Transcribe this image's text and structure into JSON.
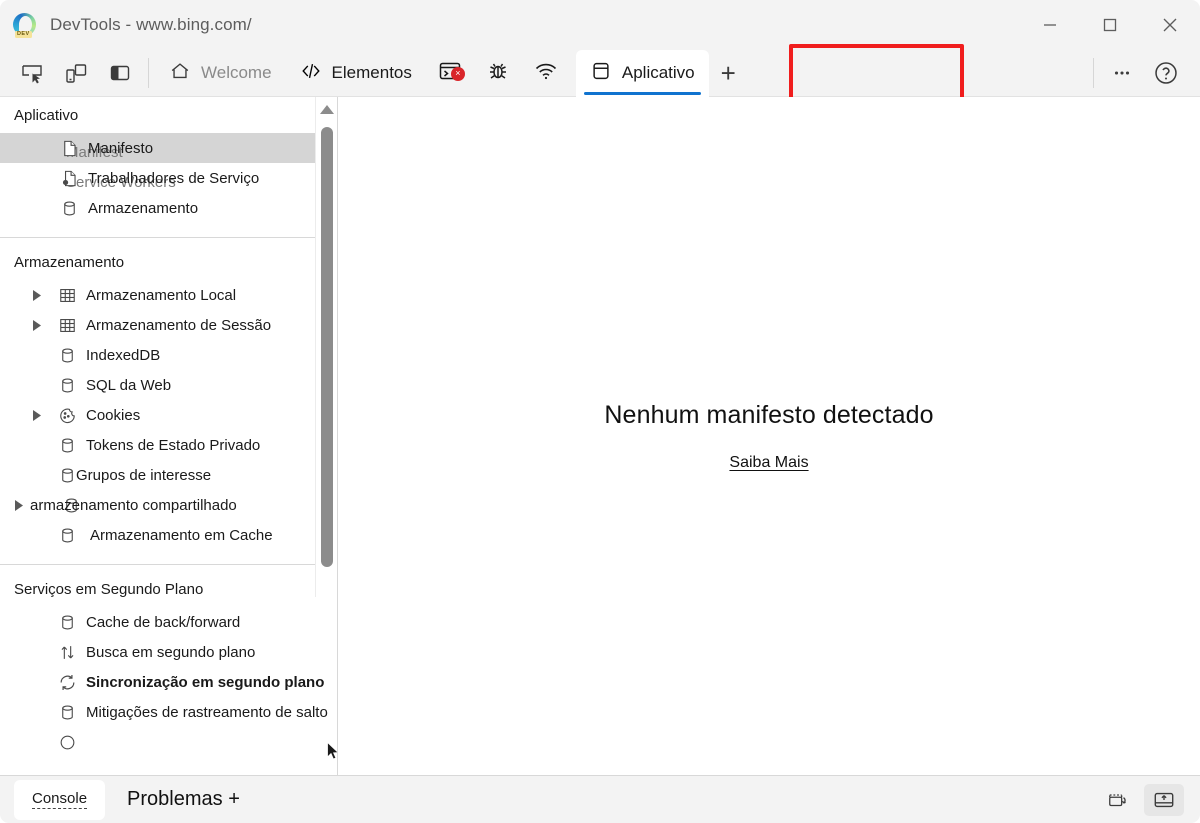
{
  "window": {
    "title": "DevTools - www.bing.com/",
    "logo_badge": "DEV",
    "controls": {
      "minimize": "minimize-button",
      "maximize": "maximize-button",
      "close": "close-button"
    }
  },
  "toolbar": {
    "left_icons": [
      {
        "name": "inspect-element-icon",
        "title": "Inspect"
      },
      {
        "name": "device-emulation-icon",
        "title": "Device emulation"
      },
      {
        "name": "panel-layout-icon",
        "title": "Panel layout"
      }
    ],
    "tabs": [
      {
        "label": "Welcome",
        "icon": "home-icon",
        "active": false
      },
      {
        "label": "Elementos",
        "icon": "code-brackets-icon",
        "active": false
      },
      {
        "label": "",
        "icon": "console-error-icon",
        "active": false,
        "badge": "×"
      },
      {
        "label": "",
        "icon": "bug-debugger-icon",
        "active": false
      },
      {
        "label": "",
        "icon": "network-wifi-icon",
        "active": false
      },
      {
        "label": "Aplicativo",
        "icon": "application-panel-icon",
        "active": true
      }
    ],
    "add_tab": "+",
    "more_options": "•••",
    "help": "?",
    "active_tab_accent": "#1073cf",
    "highlight_color": "#f01d1d"
  },
  "sidebar": {
    "sections": [
      {
        "header": "Aplicativo",
        "items": [
          {
            "label": "Manifesto",
            "icon": "document-icon",
            "selected": true,
            "twisty": false,
            "ghost": "Manifest"
          },
          {
            "label": "Trabalhadores de Serviço",
            "icon": "service-worker-icon",
            "selected": false,
            "twisty": false,
            "ghost": "Service Workers"
          },
          {
            "label": "Armazenamento",
            "icon": "database-icon",
            "selected": false,
            "twisty": false,
            "ghost": ""
          }
        ]
      },
      {
        "header": "Armazenamento",
        "items": [
          {
            "label": "Armazenamento Local",
            "icon": "table-grid-icon",
            "selected": false,
            "twisty": true,
            "ghost": ""
          },
          {
            "label": "Armazenamento de Sessão",
            "icon": "table-grid-icon",
            "selected": false,
            "twisty": true,
            "ghost": ""
          },
          {
            "label": "IndexedDB",
            "icon": "database-icon",
            "selected": false,
            "twisty": false,
            "ghost": ""
          },
          {
            "label": "SQL da Web",
            "icon": "database-icon",
            "selected": false,
            "twisty": false,
            "ghost": ""
          },
          {
            "label": "Cookies",
            "icon": "cookie-icon",
            "selected": false,
            "twisty": true,
            "ghost": ""
          },
          {
            "label": "Tokens de Estado Privado",
            "icon": "database-icon",
            "selected": false,
            "twisty": false,
            "ghost": ""
          },
          {
            "label": "Grupos de interesse",
            "icon": "database-icon",
            "selected": false,
            "twisty": false,
            "ghost": ""
          },
          {
            "label": "armazenamento compartilhado",
            "icon": "database-icon",
            "selected": false,
            "twisty": true,
            "ghost": "",
            "shifted": true
          },
          {
            "label": "Armazenamento em Cache",
            "icon": "database-icon",
            "selected": false,
            "twisty": false,
            "ghost": ""
          }
        ]
      },
      {
        "header": "Serviços em Segundo Plano",
        "items": [
          {
            "label": "Cache de back/forward",
            "icon": "database-icon",
            "selected": false,
            "twisty": false,
            "ghost": ""
          },
          {
            "label": "Busca em segundo plano",
            "icon": "arrows-updown-icon",
            "selected": false,
            "twisty": false,
            "ghost": ""
          },
          {
            "label": "Sincronização em segundo plano",
            "icon": "sync-icon",
            "selected": false,
            "twisty": false,
            "ghost": "",
            "bold": true
          },
          {
            "label": "Mitigações de rastreamento de salto",
            "icon": "database-icon",
            "selected": false,
            "twisty": false,
            "ghost": ""
          }
        ]
      }
    ]
  },
  "main": {
    "title": "Nenhum manifesto detectado",
    "link": "Saiba Mais"
  },
  "drawer": {
    "console_tab": "Console",
    "problems_tab": "Problemas +",
    "right_icons": [
      {
        "name": "restore-drawer-icon",
        "active": false
      },
      {
        "name": "open-drawer-icon",
        "active": true
      }
    ]
  }
}
